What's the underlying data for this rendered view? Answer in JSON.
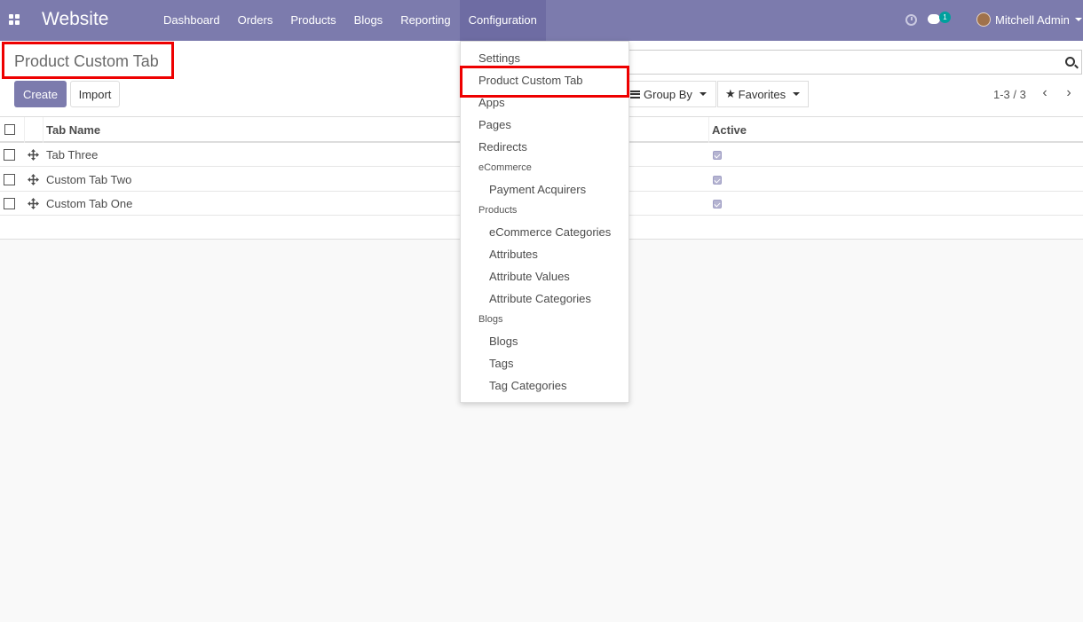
{
  "navbar": {
    "brand": "Website",
    "menu": [
      "Dashboard",
      "Orders",
      "Products",
      "Blogs",
      "Reporting",
      "Configuration"
    ],
    "active_menu": "Configuration",
    "chat_badge": "1",
    "user": "Mitchell Admin",
    "color": "#7c7bad"
  },
  "control_panel": {
    "title": "Product Custom Tab",
    "create_label": "Create",
    "import_label": "Import",
    "groupby_label": "Group By",
    "favorites_label": "Favorites",
    "pager": "1-3 / 3"
  },
  "list": {
    "columns": [
      "Tab Name",
      "Active"
    ],
    "rows": [
      {
        "name": "Tab Three",
        "active": true
      },
      {
        "name": "Custom Tab Two",
        "active": true
      },
      {
        "name": "Custom Tab One",
        "active": true
      }
    ]
  },
  "dropdown": {
    "items": [
      {
        "type": "item",
        "label": "Settings"
      },
      {
        "type": "item",
        "label": "Product Custom Tab",
        "highlighted": true
      },
      {
        "type": "item",
        "label": "Apps"
      },
      {
        "type": "item",
        "label": "Pages"
      },
      {
        "type": "item",
        "label": "Redirects"
      },
      {
        "type": "header",
        "label": "eCommerce"
      },
      {
        "type": "sub",
        "label": "Payment Acquirers"
      },
      {
        "type": "header",
        "label": "Products"
      },
      {
        "type": "sub",
        "label": "eCommerce Categories"
      },
      {
        "type": "sub",
        "label": "Attributes"
      },
      {
        "type": "sub",
        "label": "Attribute Values"
      },
      {
        "type": "sub",
        "label": "Attribute Categories"
      },
      {
        "type": "header",
        "label": "Blogs"
      },
      {
        "type": "sub",
        "label": "Blogs"
      },
      {
        "type": "sub",
        "label": "Tags"
      },
      {
        "type": "sub",
        "label": "Tag Categories"
      }
    ]
  },
  "icons": {
    "apps": "apps-grid-icon",
    "clock": "clock-icon",
    "chat": "chat-icon",
    "search": "search-icon",
    "drag": "drag-handle-icon",
    "star": "star-icon",
    "bars": "bars-icon"
  }
}
